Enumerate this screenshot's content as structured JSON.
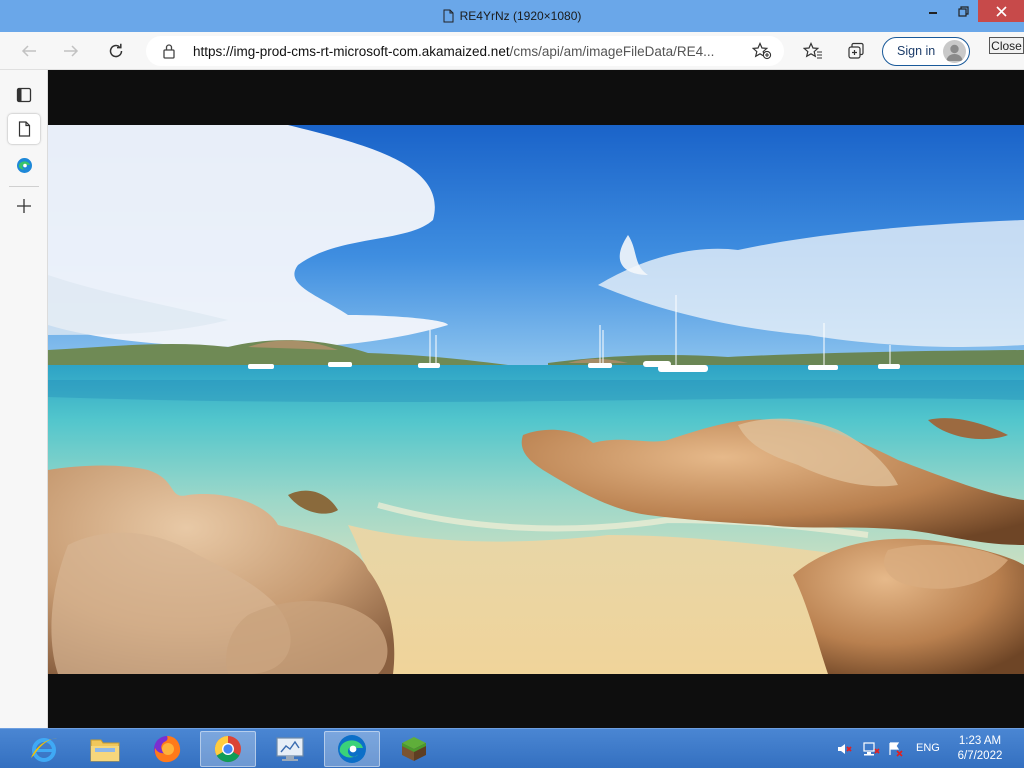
{
  "window": {
    "title": "RE4YrNz (1920×1080)"
  },
  "toolbar": {
    "url_host": "https://img-prod-cms-rt-microsoft-com.akamaized.net",
    "url_path": "/cms/api/am/imageFileData/RE4...",
    "signin_label": "Sign in",
    "close_label": "Close"
  },
  "taskbar": {
    "language": "ENG",
    "time": "1:23 AM",
    "date": "6/7/2022"
  },
  "colors": {
    "titlebar": "#6aa7e9",
    "taskbar": "#3f7bcb",
    "close_button": "#c74a4a"
  }
}
